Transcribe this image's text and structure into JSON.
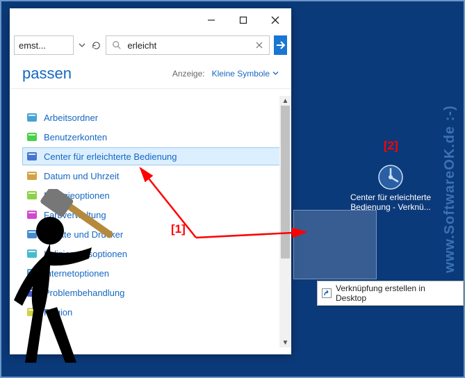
{
  "desktop": {
    "watermark": "www.SoftwareOK.de :-)",
    "icon": {
      "label": "Center für erleichterte Bedienung - Verknü..."
    },
    "tooltip": "Verknüpfung erstellen in Desktop",
    "tooltip_target": "Desktop"
  },
  "window": {
    "address": "emst...",
    "search_value": "erleicht",
    "subtitle_left": "passen",
    "view_label": "Anzeige:",
    "view_value": "Kleine Symbole",
    "items": [
      {
        "label": "Arbeitsordner",
        "icon_hue": 200
      },
      {
        "label": "Benutzerkonten",
        "icon_hue": 120
      },
      {
        "label": "Center für erleichterte Bedienung",
        "icon_hue": 220,
        "selected": true
      },
      {
        "label": "Datum und Uhrzeit",
        "icon_hue": 40
      },
      {
        "label": "Energieoptionen",
        "icon_hue": 90
      },
      {
        "label": "Farbverwaltung",
        "icon_hue": 300
      },
      {
        "label": "Geräte und Drucker",
        "icon_hue": 210
      },
      {
        "label": "Indizierungsoptionen",
        "icon_hue": 190
      },
      {
        "label": "Internetoptionen",
        "icon_hue": 200
      },
      {
        "label": "Problembehandlung",
        "icon_hue": 230
      },
      {
        "label": "Region",
        "icon_hue": 60
      }
    ]
  },
  "markers": {
    "one": "[1]",
    "two": "[2]"
  }
}
